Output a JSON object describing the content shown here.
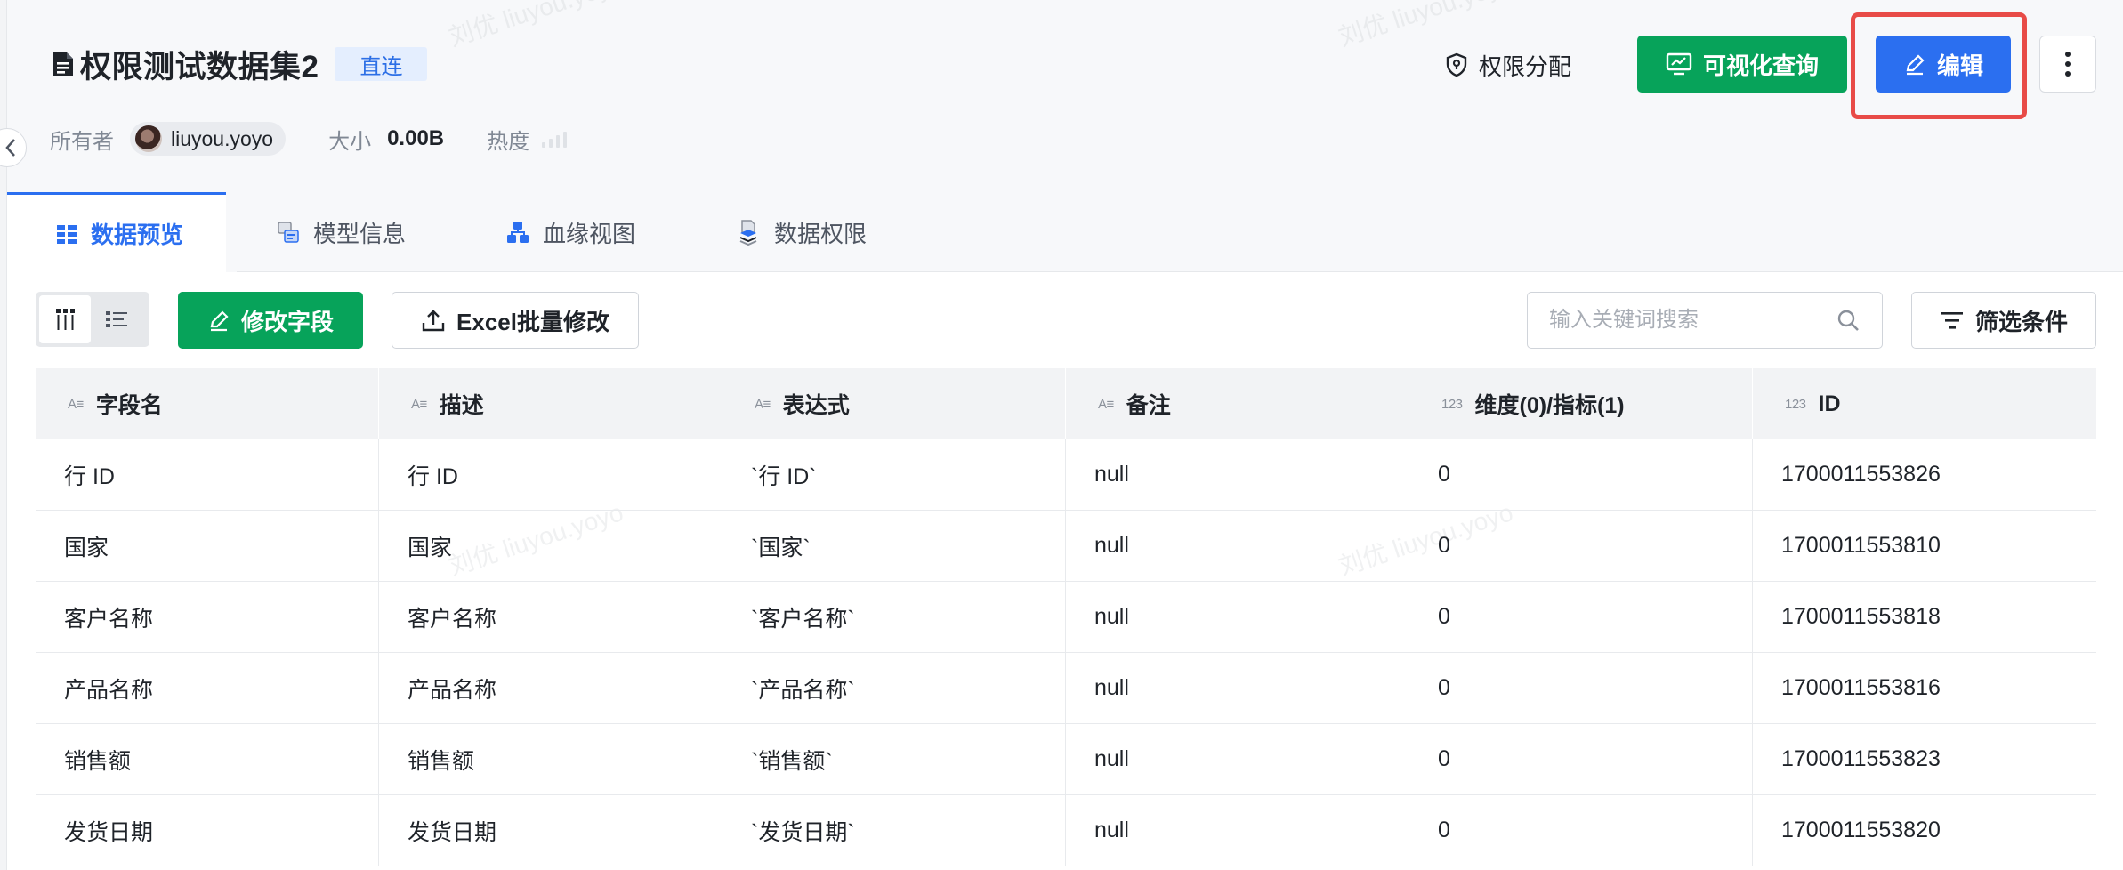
{
  "dataset": {
    "title": "权限测试数据集2",
    "badge": "直连",
    "owner_label": "所有者",
    "owner_name": "liuyou.yoyo",
    "size_label": "大小",
    "size_value": "0.00B",
    "heat_label": "热度"
  },
  "header_actions": {
    "permission_label": "权限分配",
    "visual_query_label": "可视化查询",
    "edit_label": "编辑"
  },
  "tabs": [
    {
      "label": "数据预览",
      "icon": "grid-icon",
      "active": true
    },
    {
      "label": "模型信息",
      "icon": "model-icon",
      "active": false
    },
    {
      "label": "血缘视图",
      "icon": "lineage-icon",
      "active": false
    },
    {
      "label": "数据权限",
      "icon": "data-permission-icon",
      "active": false
    }
  ],
  "toolbar": {
    "modify_fields_label": "修改字段",
    "excel_batch_label": "Excel批量修改",
    "search_placeholder": "输入关键词搜索",
    "filter_label": "筛选条件"
  },
  "table": {
    "columns": [
      {
        "label": "字段名",
        "type_icon": "A≡"
      },
      {
        "label": "描述",
        "type_icon": "A≡"
      },
      {
        "label": "表达式",
        "type_icon": "A≡"
      },
      {
        "label": "备注",
        "type_icon": "A≡"
      },
      {
        "label": "维度(0)/指标(1)",
        "type_icon": "123"
      },
      {
        "label": "ID",
        "type_icon": "123"
      }
    ],
    "rows": [
      [
        "行 ID",
        "行 ID",
        "`行 ID`",
        "null",
        "0",
        "1700011553826"
      ],
      [
        "国家",
        "国家",
        "`国家`",
        "null",
        "0",
        "1700011553810"
      ],
      [
        "客户名称",
        "客户名称",
        "`客户名称`",
        "null",
        "0",
        "1700011553818"
      ],
      [
        "产品名称",
        "产品名称",
        "`产品名称`",
        "null",
        "0",
        "1700011553816"
      ],
      [
        "销售额",
        "销售额",
        "`销售额`",
        "null",
        "0",
        "1700011553823"
      ],
      [
        "发货日期",
        "发货日期",
        "`发货日期`",
        "null",
        "0",
        "1700011553820"
      ]
    ]
  },
  "colors": {
    "primary_blue": "#2b6ff0",
    "primary_green": "#07a35a",
    "highlight_red": "#e84b47"
  }
}
